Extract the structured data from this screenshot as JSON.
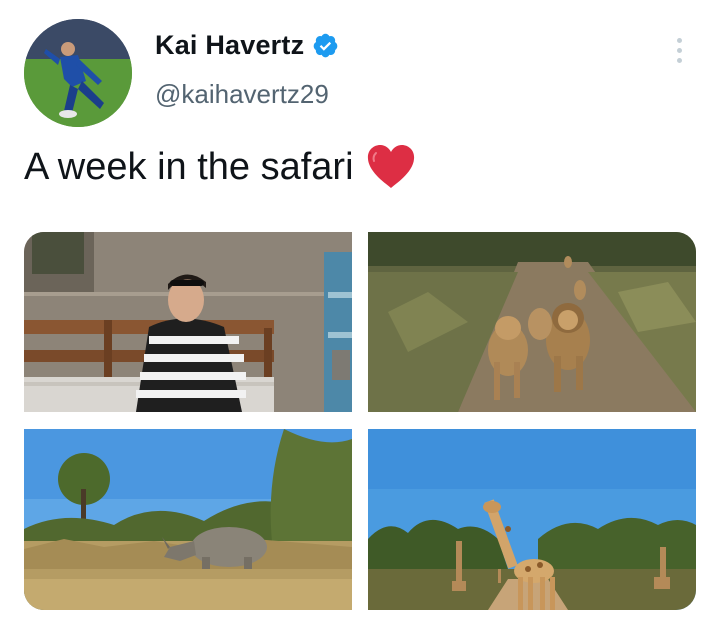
{
  "user": {
    "display_name": "Kai Havertz",
    "handle": "@kaihavertz29",
    "verified_icon": "verified-badge-icon",
    "verified_color": "#1d9bf0",
    "avatar_icon": "player-photo"
  },
  "tweet": {
    "text": "A week in the safari",
    "emoji_icon": "red-heart-icon",
    "emoji_color": "#dd2e44"
  },
  "menu": {
    "icon": "more-vertical-icon"
  },
  "media": [
    {
      "icon": "photo-man-on-bench"
    },
    {
      "icon": "photo-lions-on-road"
    },
    {
      "icon": "photo-rhino-in-grass"
    },
    {
      "icon": "photo-giraffes-on-road"
    }
  ]
}
